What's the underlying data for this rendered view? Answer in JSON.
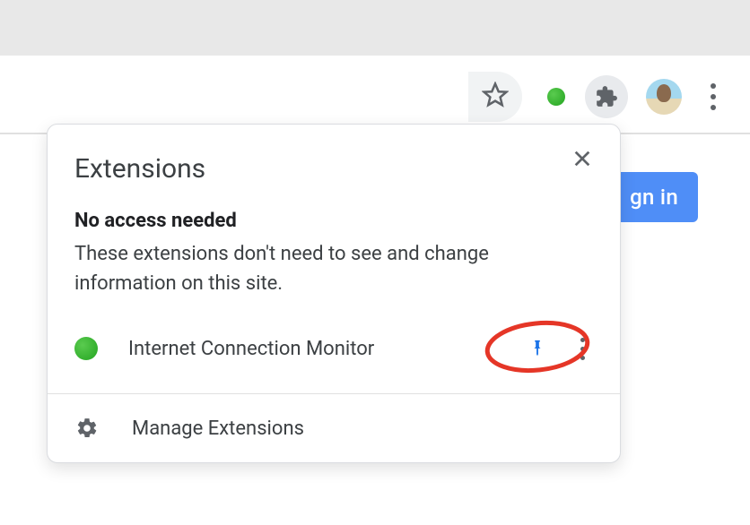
{
  "toolbar": {
    "signin_label": "gn in"
  },
  "popup": {
    "title": "Extensions",
    "section_heading": "No access needed",
    "section_desc": "These extensions don't need to see and change information on this site.",
    "extensions": [
      {
        "name": "Internet Connection Monitor"
      }
    ],
    "manage_label": "Manage Extensions"
  }
}
